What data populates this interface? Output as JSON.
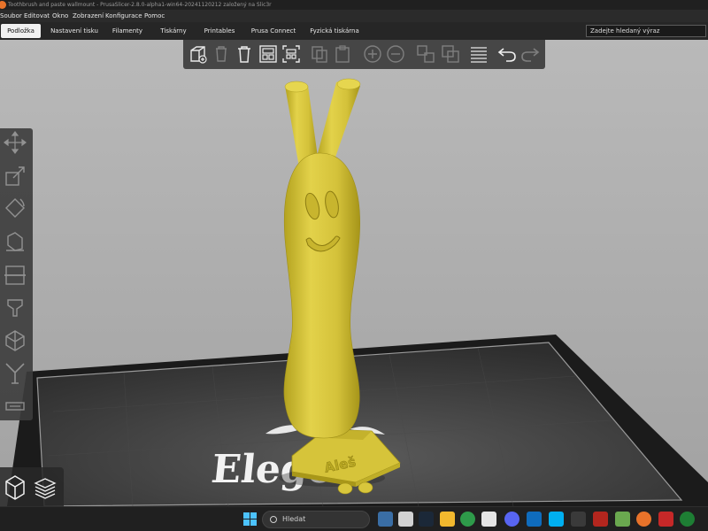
{
  "window": {
    "title": "Toothbrush and paste wallmount - PrusaSlicer-2.8.0-alpha1-win64-20241120212 založený na Slic3r"
  },
  "menu": [
    "Soubor",
    "Editovat",
    "Okno",
    "Zobrazení",
    "Konfigurace",
    "Pomoc"
  ],
  "tabs": [
    {
      "label": "Podložka",
      "active": true
    },
    {
      "label": "Nastavení tisku",
      "active": false
    },
    {
      "label": "Filamenty",
      "active": false
    },
    {
      "label": "Tiskárny",
      "active": false
    },
    {
      "label": "Printables",
      "active": false
    },
    {
      "label": "Prusa Connect",
      "active": false
    },
    {
      "label": "Fyzická tiskárna",
      "active": false
    }
  ],
  "search": {
    "placeholder": "Zadejte hledaný výraz"
  },
  "toolbar": {
    "top": [
      "add-icon",
      "delete-icon",
      "delete-all-icon",
      "arrange-icon",
      "arrange-selection-icon",
      "copy-icon",
      "paste-icon",
      "add-instance-icon",
      "remove-instance-icon",
      "split-objects-icon",
      "split-parts-icon",
      "variable-layer-height-icon",
      "undo-icon",
      "redo-icon"
    ],
    "left": [
      "move-icon",
      "scale-icon",
      "rotate-icon",
      "place-on-face-icon",
      "cut-icon",
      "support-paint-icon",
      "seam-paint-icon",
      "mmu-paint-icon",
      "emboss-icon"
    ]
  },
  "scene": {
    "bed_logo_text": "Elegoo",
    "model_emboss_text": "Aleš",
    "model_color": "#d8c63c"
  },
  "taskbar": {
    "search_label": "Hledat"
  }
}
